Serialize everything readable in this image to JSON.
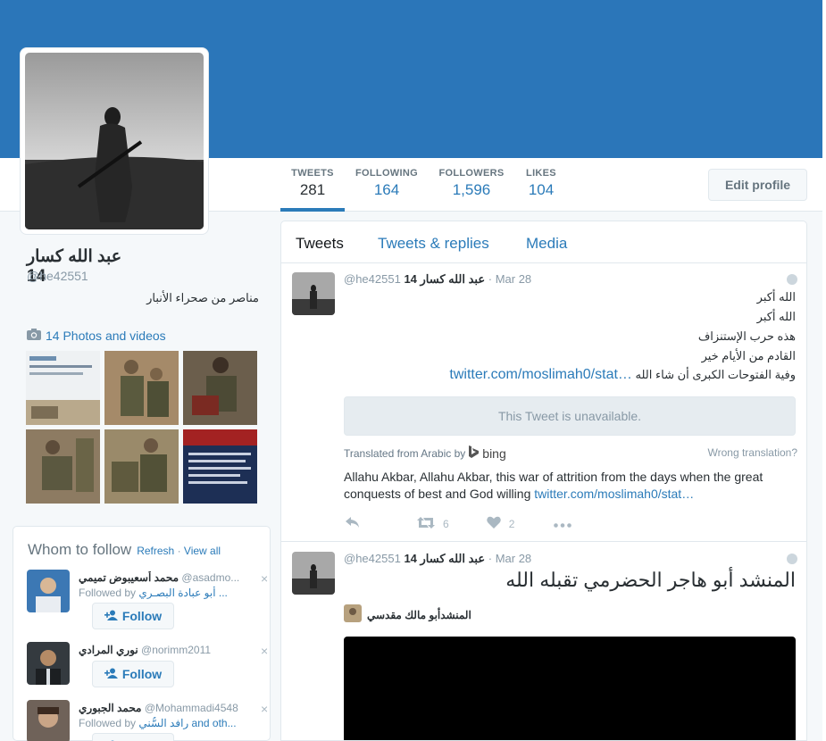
{
  "profile": {
    "name": "عبد الله كسار 14",
    "handle": "@he42551",
    "bio": "مناصر من صحراء الأنبار",
    "photos_label": "14 Photos and videos"
  },
  "stats": [
    {
      "label": "TWEETS",
      "value": "281"
    },
    {
      "label": "FOLLOWING",
      "value": "164"
    },
    {
      "label": "FOLLOWERS",
      "value": "1,596"
    },
    {
      "label": "LIKES",
      "value": "104"
    }
  ],
  "edit_profile_label": "Edit profile",
  "who_to_follow": {
    "title": "Whom to follow",
    "refresh": "Refresh",
    "view_all": "View all",
    "close_glyph": "×",
    "follow_label": "Follow",
    "users": [
      {
        "name": "محمد أسعيبوض تميمي",
        "handle": "@asadmo...",
        "followed_prefix": "Followed by",
        "followed_by": "أبو عبادة البصـري ...",
        "followed_suffix": ""
      },
      {
        "name": "نوري المرادي",
        "handle": "@norimm2011",
        "followed_prefix": "",
        "followed_by": "",
        "followed_suffix": ""
      },
      {
        "name": "محمد الجبوري",
        "handle": "@Mohammadi4548",
        "followed_prefix": "Followed by",
        "followed_by": "رافد السُّني",
        "followed_suffix": " and oth..."
      }
    ]
  },
  "tabs": [
    "Tweets",
    "Tweets & replies",
    "Media"
  ],
  "tweets": [
    {
      "name": "عبد الله كسار 14",
      "handle": "@he42551",
      "date": "· Mar 28",
      "lines": [
        "الله أكبر",
        "الله أكبر",
        "هذه حرب الإستنزاف",
        "القادم من الأيام خير",
        "وفية الفتوحات الكبرى أن شاء الله"
      ],
      "link": "twitter.com/moslimah0/stat…",
      "unavailable": "This Tweet is unavailable.",
      "translated_from": "Translated from Arabic by",
      "translator": "bing",
      "wrong": "Wrong translation?",
      "translation": "Allahu Akbar, Allahu Akbar, this war of attrition from the days when the great conquests of best and God willing ",
      "translation_link": "twitter.com/moslimah0/stat…",
      "retweets": "6",
      "likes": "2"
    },
    {
      "name": "عبد الله كسار 14",
      "handle": "@he42551",
      "date": "· Mar 28",
      "text": "المنشد أبو هاجر الحضرمي تقبله الله",
      "media_user": "المنشدأبو مالك مقدسي"
    }
  ],
  "icons": [
    "camera-icon",
    "reply-icon",
    "retweet-icon",
    "heart-icon",
    "more-icon",
    "globe-icon",
    "bing-icon",
    "add-user-icon",
    "close-icon"
  ],
  "colors": {
    "accent": "#2b7bb9",
    "banner": "#2b76b9",
    "background": "#f5f8fa"
  }
}
